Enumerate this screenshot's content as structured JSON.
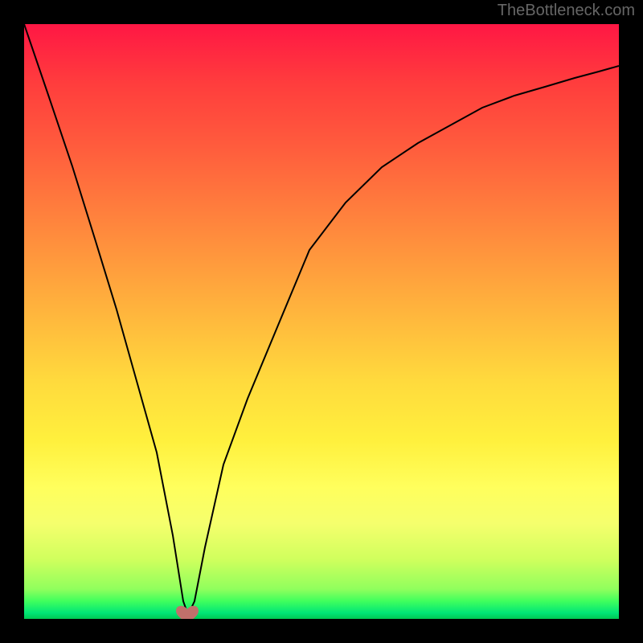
{
  "watermark": "TheBottleneck.com",
  "chart_data": {
    "type": "line",
    "title": "",
    "xlabel": "",
    "ylabel": "",
    "xlim": [
      0,
      100
    ],
    "ylim": [
      0,
      100
    ],
    "series": [
      {
        "name": "bottleneck-curve",
        "x": [
          0,
          2,
          4,
          6,
          8,
          10,
          12,
          14,
          15,
          16,
          17,
          18,
          20,
          22,
          25,
          30,
          35,
          40,
          45,
          50,
          55,
          60,
          65,
          70,
          75,
          80,
          85,
          90,
          95,
          100
        ],
        "values": [
          100,
          88,
          76,
          64,
          52,
          40,
          28,
          14,
          3,
          0,
          3,
          12,
          26,
          37,
          49,
          62,
          70,
          76,
          80,
          83,
          86,
          88,
          89.5,
          91,
          92,
          93,
          93.8,
          94.5,
          95,
          95.5
        ]
      }
    ],
    "marker": {
      "x": 16,
      "y": 0,
      "shape": "heart"
    }
  }
}
